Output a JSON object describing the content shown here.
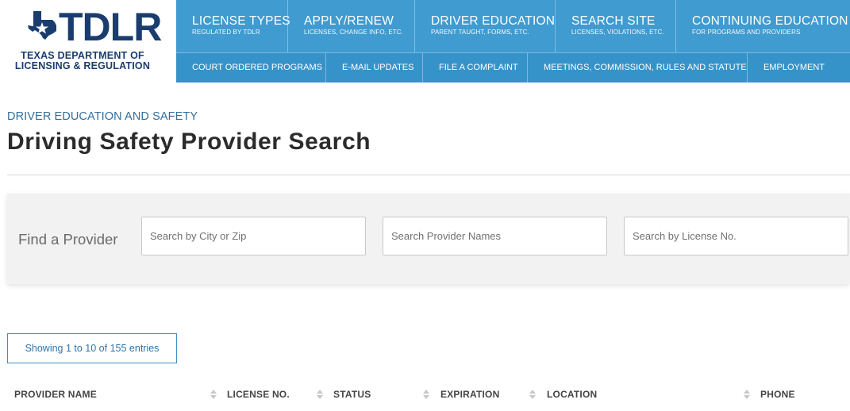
{
  "brand": {
    "logo_text": "TDLR",
    "logo_subtitle": "TEXAS DEPARTMENT OF LICENSING & REGULATION",
    "logo_color": "#1b3d6e",
    "mark_icon": "texas-star-icon"
  },
  "nav": {
    "primary": [
      {
        "title": "LICENSE TYPES",
        "subtitle": "REGULATED BY TDLR"
      },
      {
        "title": "APPLY/RENEW",
        "subtitle": "LICENSES, CHANGE INFO, ETC."
      },
      {
        "title": "DRIVER EDUCATION",
        "subtitle": "PARENT TAUGHT, FORMS, ETC."
      },
      {
        "title": "SEARCH SITE",
        "subtitle": "LICENSES, VIOLATIONS, ETC."
      },
      {
        "title": "CONTINUING EDUCATION",
        "subtitle": "FOR PROGRAMS AND PROVIDERS"
      }
    ],
    "secondary": [
      "COURT ORDERED PROGRAMS",
      "E-MAIL UPDATES",
      "FILE A COMPLAINT",
      "MEETINGS, COMMISSION, RULES AND STATUTE",
      "EMPLOYMENT"
    ],
    "color": "#3f9bd0"
  },
  "page": {
    "section_label": "DRIVER EDUCATION AND SAFETY",
    "title": "Driving Safety Provider Search"
  },
  "search": {
    "label": "Find a Provider",
    "city_placeholder": "Search by City or Zip",
    "name_placeholder": "Search Provider Names",
    "license_placeholder": "Search by License No.",
    "city_value": "",
    "name_value": "",
    "license_value": ""
  },
  "results": {
    "showing": "Showing 1 to 10 of 155 entries",
    "columns": [
      "PROVIDER NAME",
      "LICENSE NO.",
      "STATUS",
      "EXPIRATION",
      "LOCATION",
      "PHONE"
    ]
  }
}
